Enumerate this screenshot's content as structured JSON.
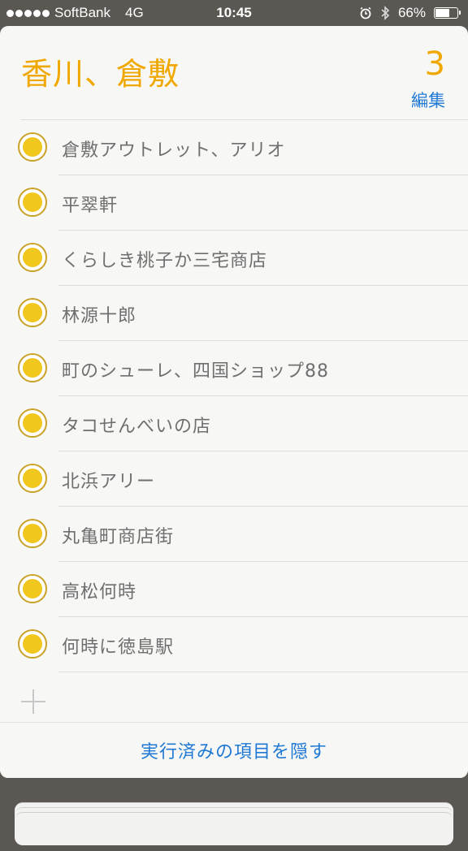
{
  "status": {
    "carrier": "SoftBank",
    "network": "4G",
    "time": "10:45",
    "battery": "66%",
    "battery_level": 0.66
  },
  "list": {
    "title": "香川、倉敷",
    "count": "3",
    "edit_label": "編集",
    "items": [
      "倉敷アウトレット、アリオ",
      "平翠軒",
      "くらしき桃子か三宅商店",
      "林源十郎",
      "町のシューレ、四国ショップ88",
      "タコせんべいの店",
      "北浜アリー",
      "丸亀町商店街",
      "高松何時",
      "何時に徳島駅"
    ],
    "hide_completed_label": "実行済みの項目を隠す"
  },
  "colors": {
    "accent": "#f0a800",
    "link": "#1f78d4",
    "check_fill": "#f1c71e"
  },
  "icons": [
    "alarm-icon",
    "bluetooth-icon",
    "battery-icon",
    "plus-icon",
    "circle-checkbox-icon"
  ]
}
